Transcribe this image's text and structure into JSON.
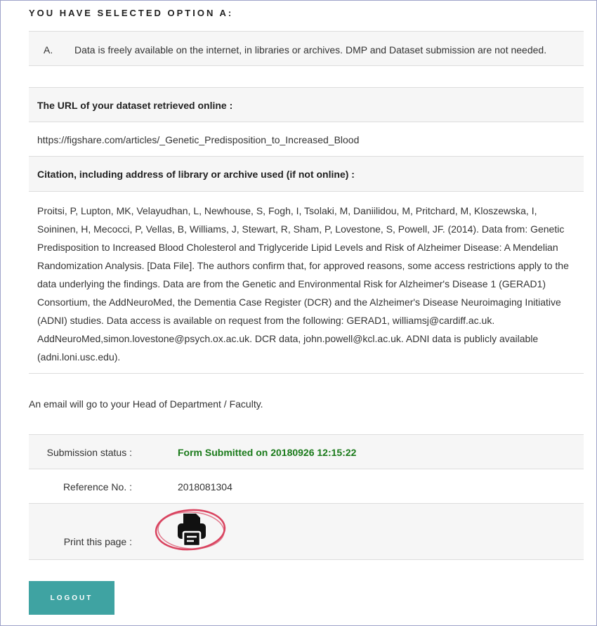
{
  "heading": "YOU HAVE SELECTED OPTION A:",
  "option": {
    "letter": "A.",
    "text": "Data is freely available on the internet, in libraries or archives. DMP and Dataset submission are not needed."
  },
  "url_section": {
    "label": "The URL of your dataset retrieved online :",
    "value": "https://figshare.com/articles/_Genetic_Predisposition_to_Increased_Blood"
  },
  "citation_section": {
    "label": "Citation, including address of library or archive used (if not online) :",
    "value": "Proitsi, P, Lupton, MK, Velayudhan, L, Newhouse, S, Fogh, I, Tsolaki, M, Daniilidou, M, Pritchard, M, Kloszewska, I, Soininen, H, Mecocci, P, Vellas, B, Williams, J, Stewart, R, Sham, P, Lovestone, S, Powell, JF. (2014). Data from: Genetic Predisposition to Increased Blood Cholesterol and Triglyceride Lipid Levels and Risk of Alzheimer Disease: A Mendelian Randomization Analysis. [Data File]. The authors confirm that, for approved reasons, some access restrictions apply to the data underlying the findings. Data are from the Genetic and Environmental Risk for Alzheimer's Disease 1 (GERAD1) Consortium, the AddNeuroMed, the Dementia Case Register (DCR) and the Alzheimer's Disease Neuroimaging Initiative (ADNI) studies. Data access is available on request from the following: GERAD1, williamsj@cardiff.ac.uk. AddNeuroMed,simon.lovestone@psych.ox.ac.uk. DCR data, john.powell@kcl.ac.uk. ADNI data is publicly available (adni.loni.usc.edu)."
  },
  "email_note": "An email will go to your Head of Department / Faculty.",
  "submission": {
    "status_label": "Submission status :",
    "status_value": "Form Submitted on 20180926 12:15:22",
    "status_color": "#1a7a1a",
    "ref_label": "Reference No. :",
    "ref_value": "2018081304",
    "print_label": "Print this page :",
    "print_icon": "printer-icon",
    "highlight_color": "#d9435f"
  },
  "logout_label": "LOGOUT",
  "accent_color": "#3fa3a2"
}
